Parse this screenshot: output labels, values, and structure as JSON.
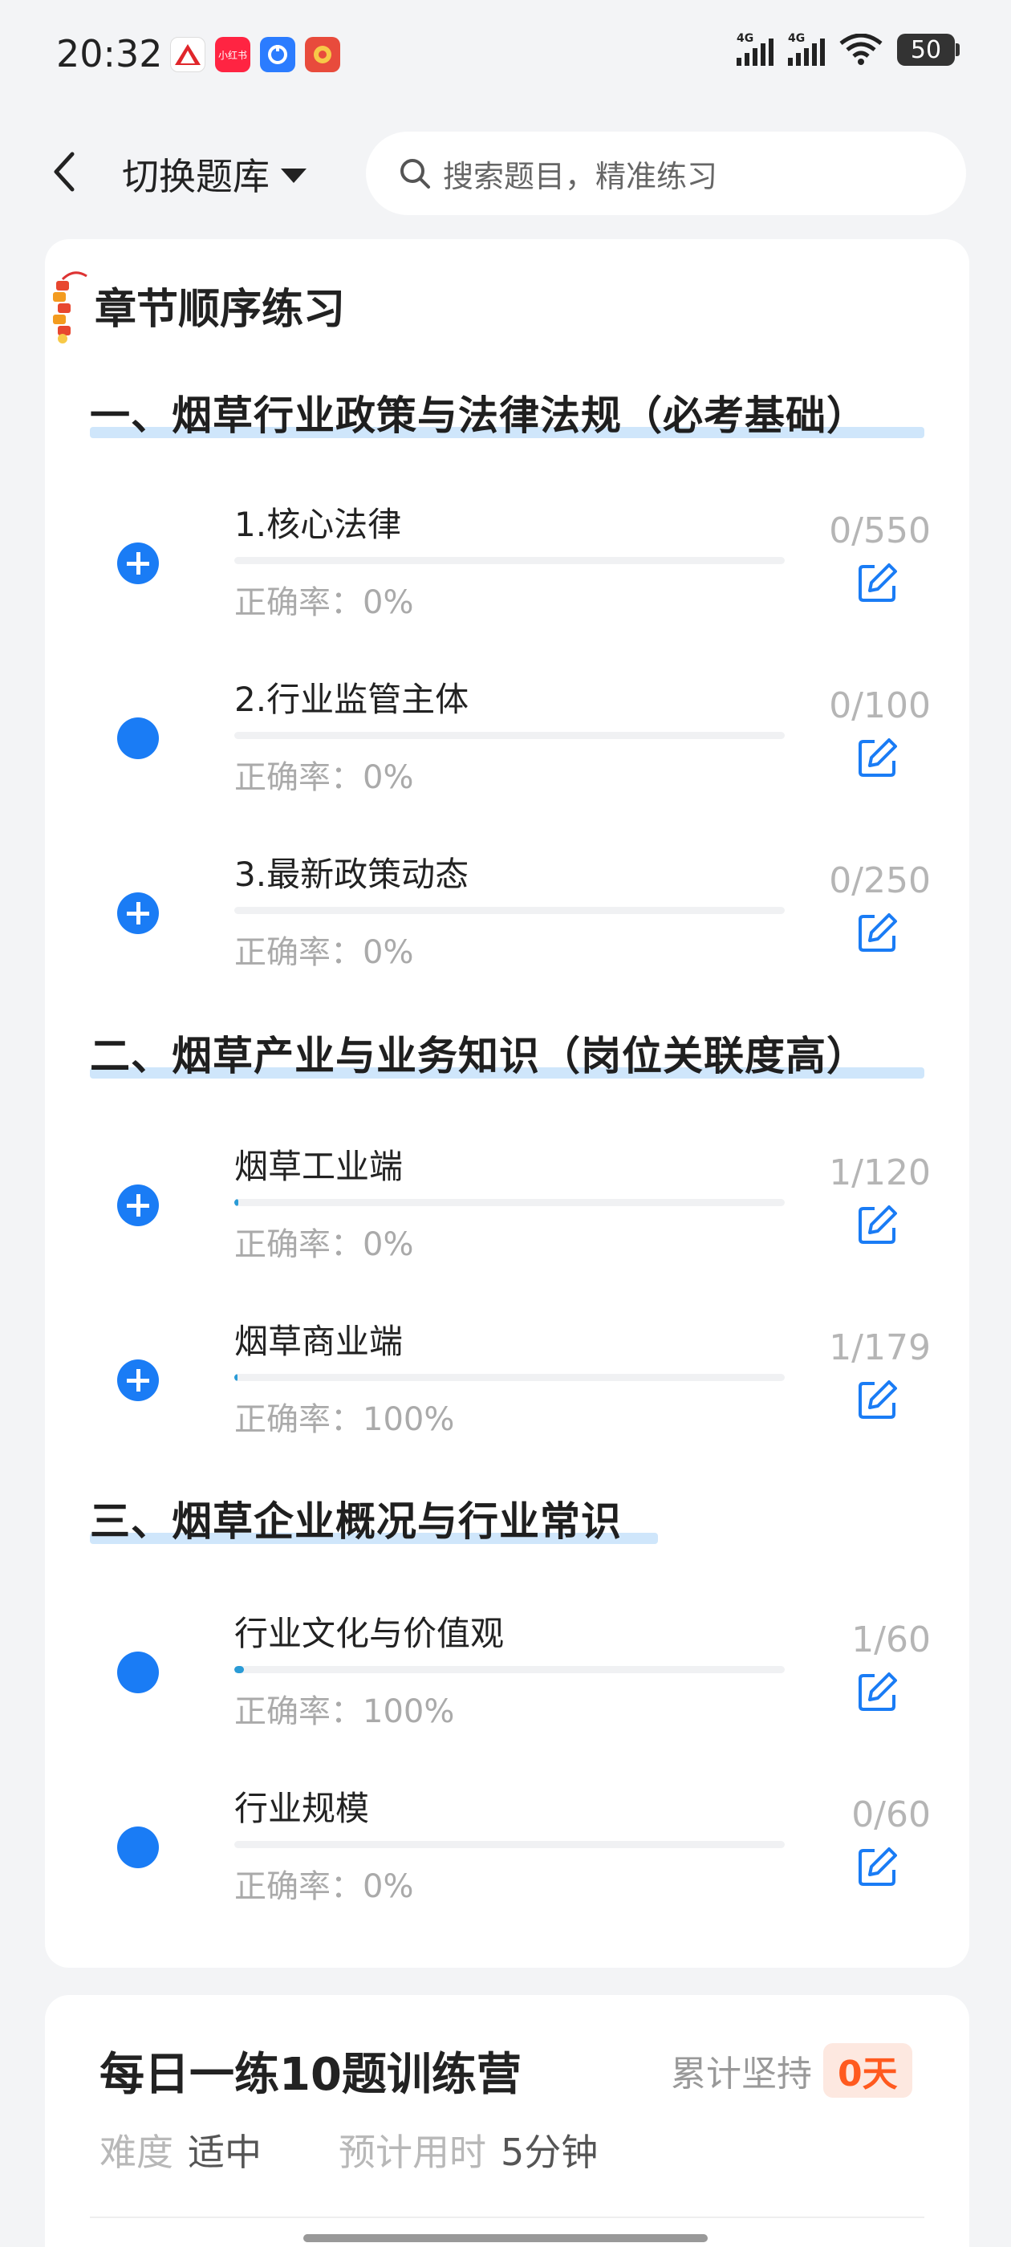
{
  "status_bar": {
    "time": "20:32",
    "battery": "50",
    "network1": "4G",
    "network2": "4G",
    "app_icon_labels": [
      "",
      "小红书",
      "",
      ""
    ]
  },
  "nav": {
    "bank_label": "切换题库",
    "search_placeholder": "搜索题目，精准练习"
  },
  "card": {
    "title": "章节顺序练习",
    "accuracy_prefix": "正确率：",
    "sections": [
      {
        "title": "一、烟草行业政策与法律法规（必考基础）",
        "items": [
          {
            "name": "1.核心法律",
            "accuracy": "正确率：0%",
            "count": "0/550",
            "progress": 0,
            "expandable": true
          },
          {
            "name": "2.行业监管主体",
            "accuracy": "正确率：0%",
            "count": "0/100",
            "progress": 0,
            "expandable": false
          },
          {
            "name": "3.最新政策动态",
            "accuracy": "正确率：0%",
            "count": "0/250",
            "progress": 0,
            "expandable": true
          }
        ]
      },
      {
        "title": "二、烟草产业与业务知识（岗位关联度高）",
        "items": [
          {
            "name": "烟草工业端",
            "accuracy": "正确率：0%",
            "count": "1/120",
            "progress": 0.008,
            "expandable": true
          },
          {
            "name": "烟草商业端",
            "accuracy": "正确率：100%",
            "count": "1/179",
            "progress": 0.006,
            "expandable": true
          }
        ]
      },
      {
        "title": "三、烟草企业概况与行业常识",
        "items": [
          {
            "name": "行业文化与价值观",
            "accuracy": "正确率：100%",
            "count": "1/60",
            "progress": 0.017,
            "expandable": false
          },
          {
            "name": "行业规模",
            "accuracy": "正确率：0%",
            "count": "0/60",
            "progress": 0,
            "expandable": false
          }
        ]
      }
    ]
  },
  "daily": {
    "title": "每日一练10题训练营",
    "streak_label": "累计坚持",
    "streak_value": "0天",
    "difficulty_label": "难度",
    "difficulty_value": "适中",
    "time_label": "预计用时",
    "time_value": "5分钟"
  },
  "colors": {
    "accent": "#1a7cf5",
    "progress": "#2a9bd6",
    "highlight": "#cfe6fb",
    "streak": "#ff5a1f"
  }
}
